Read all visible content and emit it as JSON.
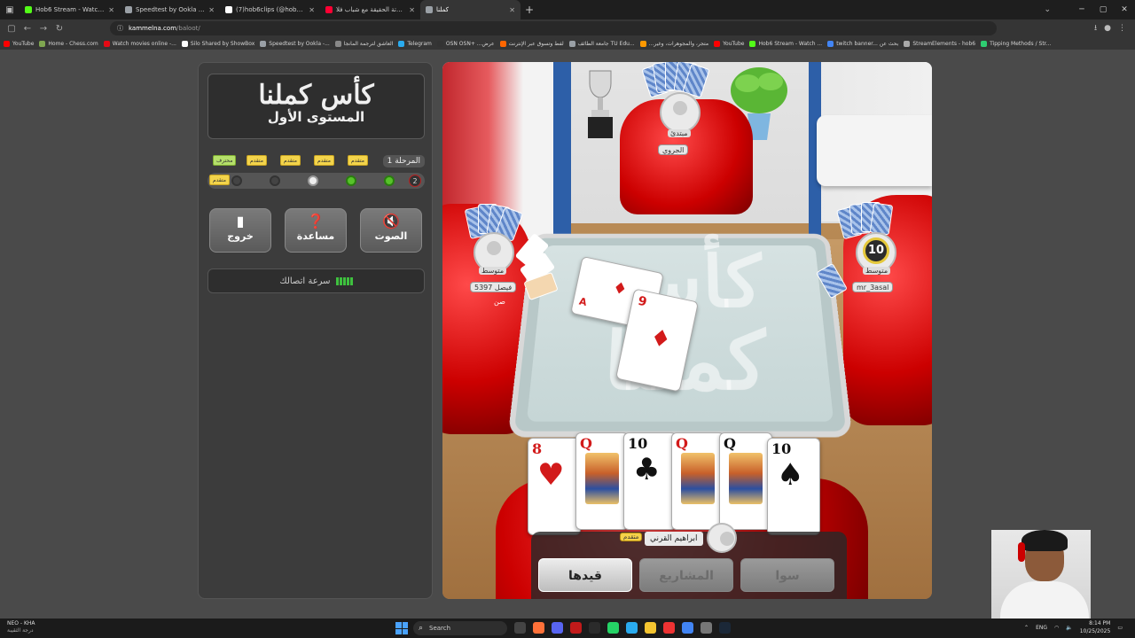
{
  "browser": {
    "tabs": [
      {
        "label": "Hob6 Stream - Watch Live on K",
        "color": "#53fc18",
        "active": false
      },
      {
        "label": "Speedtest by Ookla - The Glob",
        "color": "#9aa0a6",
        "active": false
      },
      {
        "label": "(7)hob6clips (@hob6m) | TikTok",
        "color": "#ffffff",
        "active": false
      },
      {
        "label": "تحدي بلوتة الحقيقة مع شباب فلا",
        "color": "#ff0033",
        "active": false
      },
      {
        "label": "كملنا",
        "color": "#9aa0a6",
        "active": true
      }
    ],
    "url_domain": "kammelna.com",
    "url_path": "/baloot/",
    "bookmarks": [
      {
        "label": "YouTube",
        "color": "#ff0000"
      },
      {
        "label": "Home - Chess.com",
        "color": "#7fa650"
      },
      {
        "label": "Watch movies online -...",
        "color": "#e50914"
      },
      {
        "label": "Silo Shared by ShowBox",
        "color": "#ffffff"
      },
      {
        "label": "Speedtest by Ookla -...",
        "color": "#9aa0a6"
      },
      {
        "label": "العاشق لترجمة المانجا",
        "color": "#888888"
      },
      {
        "label": "Telegram",
        "color": "#2aabee"
      },
      {
        "label": "OSN  OSN+ ...عرض",
        "color": "#333333"
      },
      {
        "label": "لفط وتسوق عبر الإنترنت",
        "color": "#ff6600"
      },
      {
        "label": "جامعة الطائف  TU Edu...",
        "color": "#9aa0a6"
      },
      {
        "label": "...متجر، والمجوهرات، وغير",
        "color": "#ff9900"
      },
      {
        "label": "YouTube",
        "color": "#ff0000"
      },
      {
        "label": "Hob6 Stream - Watch ...",
        "color": "#53fc18"
      },
      {
        "label": "twitch banner... بحث عن",
        "color": "#4285f4"
      },
      {
        "label": "StreamElements - hob6",
        "color": "#aaaaaa"
      },
      {
        "label": "Tipping Methods / Str...",
        "color": "#2ecc71"
      }
    ]
  },
  "panel": {
    "logo_main": "كأس كملنا",
    "logo_sub": "المستوى الأول",
    "stage_label": "المرحلة 1",
    "ranks": [
      "محترف",
      "متقدم",
      "متقدم",
      "متقدم",
      "متقدم"
    ],
    "current_rank": "متقدم",
    "track_current": "2",
    "buttons": {
      "exit": "خروج",
      "help": "مساعدة",
      "sound": "الصوت"
    },
    "connection_label": "سرعة اتصالك"
  },
  "board": {
    "table_logo": "كأس كملنا",
    "top_player": {
      "rank": "مبتدئ",
      "name": "الجروي"
    },
    "left_player": {
      "rank": "متوسط",
      "score": "5397",
      "name": "فيصل",
      "bid": "صن"
    },
    "right_player": {
      "rank": "متوسط",
      "name": "mr_3asal",
      "timer": "10"
    },
    "me": {
      "name": "ابراهيم القرني",
      "rank": "متقدم"
    },
    "table_cards": [
      {
        "rank": "A",
        "suit": "♦"
      },
      {
        "rank": "9",
        "suit": "♦"
      }
    ],
    "hand": [
      {
        "rank": "8",
        "suit": "♥",
        "color": "red",
        "court": false
      },
      {
        "rank": "Q",
        "suit": "♥",
        "color": "red",
        "court": true
      },
      {
        "rank": "10",
        "suit": "♣",
        "color": "black",
        "court": false
      },
      {
        "rank": "Q",
        "suit": "♦",
        "color": "red",
        "court": true
      },
      {
        "rank": "Q",
        "suit": "♣",
        "color": "black",
        "court": true
      },
      {
        "rank": "10",
        "suit": "♠",
        "color": "black",
        "court": false
      }
    ],
    "actions": {
      "record": "قيدها",
      "projects": "المشاريع",
      "sawa": "سوا"
    }
  },
  "taskbar": {
    "weather_title": "NEO - KHA",
    "weather_sub": "درجة الثقيبة",
    "search": "Search",
    "lang": "ENG",
    "time": "8:14 PM",
    "date": "10/25/2025"
  }
}
